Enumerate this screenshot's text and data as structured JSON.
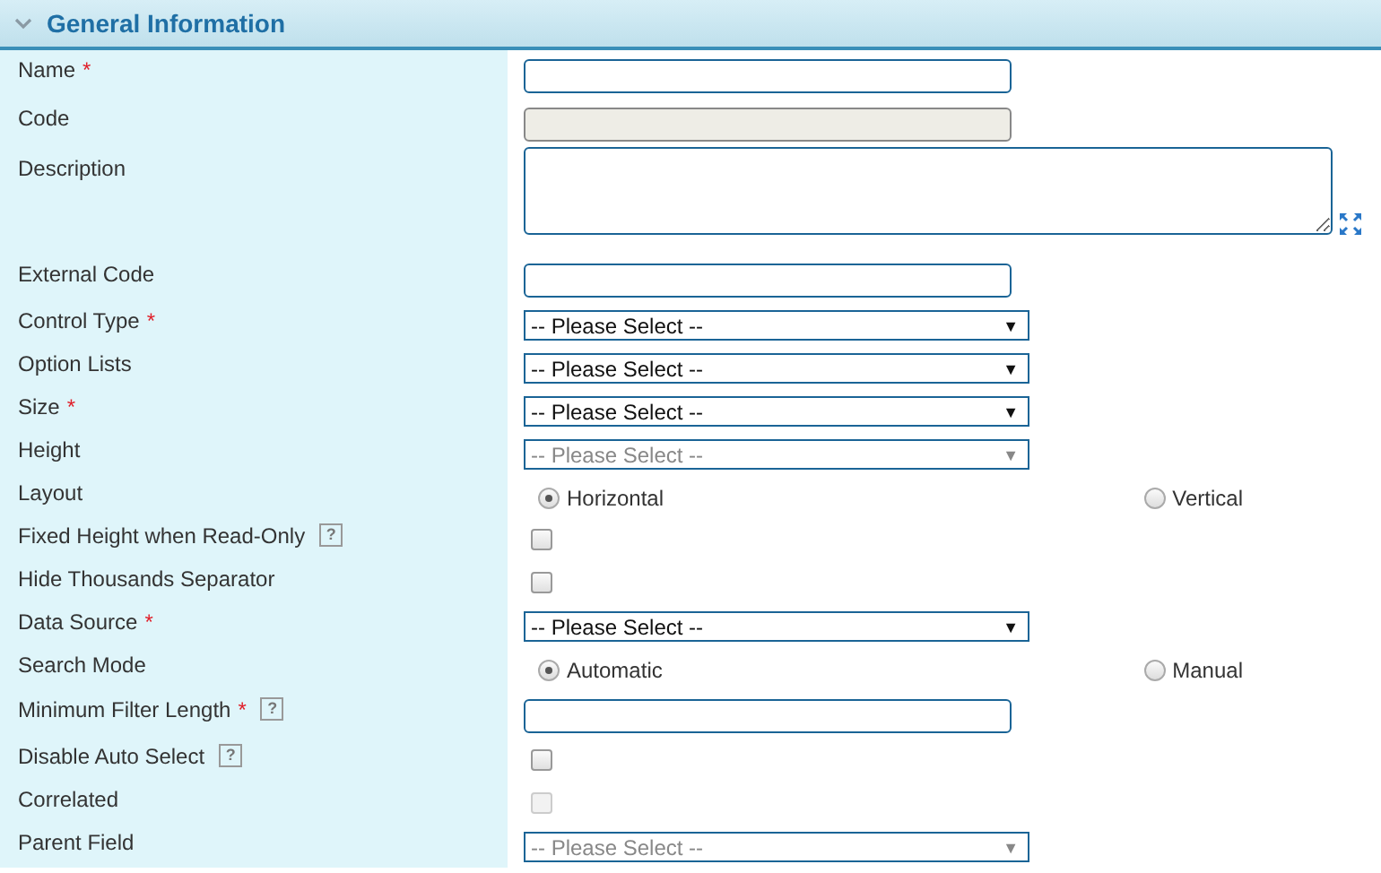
{
  "section": {
    "title": "General Information",
    "expanded": true
  },
  "fields": [
    {
      "label": "Name",
      "required_mark": "*",
      "kind": "text",
      "disabled": false
    },
    {
      "label": "Code",
      "kind": "text",
      "disabled": true
    },
    {
      "label": "Description",
      "kind": "textarea"
    },
    {
      "label": "External Code",
      "kind": "text",
      "disabled": false
    },
    {
      "label": "Control Type",
      "required_mark": "*",
      "kind": "select",
      "value": "-- Please Select --",
      "caret": "▼",
      "disabled": false
    },
    {
      "label": "Option Lists",
      "kind": "select",
      "value": "-- Please Select --",
      "caret": "▼",
      "disabled": false
    },
    {
      "label": "Size",
      "required_mark": "*",
      "kind": "select",
      "value": "-- Please Select --",
      "caret": "▼",
      "disabled": false
    },
    {
      "label": "Height",
      "kind": "select",
      "value": "-- Please Select --",
      "caret": "▼",
      "disabled": true
    },
    {
      "label": "Layout",
      "kind": "radio",
      "options": [
        {
          "label": "Horizontal",
          "selected": true
        },
        {
          "label": "Vertical",
          "selected": false
        }
      ]
    },
    {
      "label": "Fixed Height when Read-Only",
      "help": "?",
      "kind": "checkbox",
      "checked": false,
      "disabled": false
    },
    {
      "label": "Hide Thousands Separator",
      "kind": "checkbox",
      "checked": false,
      "disabled": false
    },
    {
      "label": "Data Source",
      "required_mark": "*",
      "kind": "select",
      "value": "-- Please Select --",
      "caret": "▼",
      "disabled": false
    },
    {
      "label": "Search Mode",
      "kind": "radio",
      "options": [
        {
          "label": "Automatic",
          "selected": true
        },
        {
          "label": "Manual",
          "selected": false
        }
      ]
    },
    {
      "label": "Minimum Filter Length",
      "required_mark": "*",
      "help": "?",
      "kind": "text",
      "disabled": false
    },
    {
      "label": "Disable Auto Select",
      "help": "?",
      "kind": "checkbox",
      "checked": false,
      "disabled": false
    },
    {
      "label": "Correlated",
      "kind": "checkbox",
      "checked": false,
      "disabled": true
    },
    {
      "label": "Parent Field",
      "kind": "select",
      "value": "-- Please Select --",
      "caret": "▼",
      "disabled": true
    }
  ]
}
